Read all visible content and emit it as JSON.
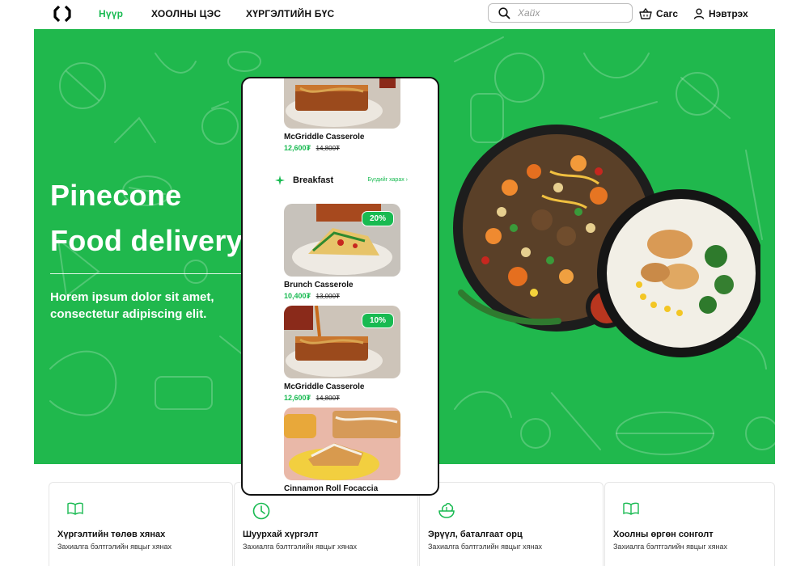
{
  "nav": {
    "links": [
      {
        "label": "Нүүр",
        "active": true
      },
      {
        "label": "ХООЛНЫ ЦЭС",
        "active": false
      },
      {
        "label": "ХҮРГЭЛТИЙН БҮС",
        "active": false
      }
    ],
    "search_placeholder": "Хайх",
    "cart_label": "Сагс",
    "login_label": "Нэвтрэх",
    "accent_color": "#18ba51"
  },
  "hero": {
    "title_line1": "Pinecone",
    "title_line2": "Food delivery",
    "subtitle": "Horem ipsum dolor sit amet, consectetur adipiscing elit.",
    "background_color": "#20b84d"
  },
  "phone": {
    "top_card": {
      "name": "McGriddle Casserole",
      "price": "12,600₮",
      "old_price": "14,800₮"
    },
    "section": {
      "title": "Breakfast",
      "link": "Бүгдийг харах"
    },
    "cards": [
      {
        "name": "Brunch Casserole",
        "price": "10,400₮",
        "old_price": "13,000₮",
        "badge": "20%"
      },
      {
        "name": "McGriddle Casserole",
        "price": "12,600₮",
        "old_price": "14,800₮",
        "badge": "10%"
      },
      {
        "name": "Cinnamon Roll Focaccia"
      }
    ]
  },
  "features": [
    {
      "title": "Хүргэлтийн төлөв хянах",
      "desc": "Захиалга бэлтгэлийн явцыг хянах",
      "icon": "book-icon"
    },
    {
      "title": "Шуурхай хүргэлт",
      "desc": "Захиалга бэлтгэлийн явцыг хянах",
      "icon": "clock-icon"
    },
    {
      "title": "Эрүүл, баталгаат орц",
      "desc": "Захиалга бэлтгэлийн явцыг хянах",
      "icon": "salad-icon"
    },
    {
      "title": "Хоолны өргөн сонголт",
      "desc": "Захиалга бэлтгэлийн явцыг хянах",
      "icon": "book-icon"
    }
  ]
}
